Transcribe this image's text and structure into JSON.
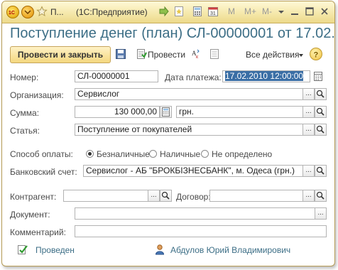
{
  "titlebar": {
    "doc_tab": "П...",
    "app_name": "(1С:Предприятие)",
    "m_label": "M",
    "mplus_label": "M+",
    "mminus_label": "M-"
  },
  "heading": "Поступление денег (план) СЛ-00000001 от 17.02.2...",
  "toolbar": {
    "post_close_label": "Провести и закрыть",
    "post_label": "Провести",
    "all_actions_label": "Все действия"
  },
  "form": {
    "number_label": "Номер:",
    "number_value": "СЛ-00000001",
    "pay_date_label": "Дата платежа:",
    "pay_date_value": "17.02.2010 12:00:00",
    "org_label": "Организация:",
    "org_value": "Сервислог",
    "sum_label": "Сумма:",
    "sum_value": "130 000,00",
    "currency_value": "грн.",
    "article_label": "Статья:",
    "article_value": "Поступление от покупателей",
    "pay_method_label": "Способ оплаты:",
    "pay_methods": [
      {
        "label": "Безналичные",
        "selected": true
      },
      {
        "label": "Наличные",
        "selected": false
      },
      {
        "label": "Не определено",
        "selected": false
      }
    ],
    "bank_label": "Банковский счет:",
    "bank_value": "Сервислог - АБ \"БРОКБІЗНЕСБАНК\", м. Одеса (грн.)",
    "counterparty_label": "Контрагент:",
    "counterparty_value": "",
    "contract_label": "Договор:",
    "contract_value": "",
    "document_label": "Документ:",
    "document_value": "",
    "comment_label": "Комментарий:",
    "comment_value": ""
  },
  "status": {
    "posted_label": "Проведен",
    "author_name": "Абдулов Юрий Владимирович"
  }
}
